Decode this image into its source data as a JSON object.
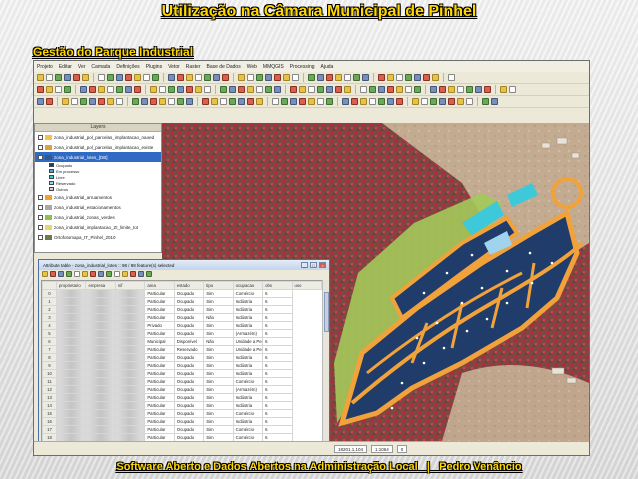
{
  "slide": {
    "title": "Utilização na Câmara Municipal de Pinhel",
    "subtitle": "Gestão do Parque Industrial",
    "footer": "Software Aberto e Dados Abertos na Administração Local   |   Pedro Venâncio"
  },
  "app": {
    "menu": [
      "Projeto",
      "Editar",
      "Ver",
      "Camada",
      "Definições",
      "Plugins",
      "Vetor",
      "Raster",
      "Base de Dados",
      "Web",
      "MMQGIS",
      "Processing",
      "Ajuda"
    ],
    "layers_panel": {
      "title": "Layers",
      "layers": [
        {
          "name": "zona_industrial_pol_parcelas_implantacao_naoed",
          "color": "#f2c24a",
          "checked": true,
          "selected": false
        },
        {
          "name": "zona_industrial_pol_parcelas_implantacao_existe",
          "color": "#d9a23a",
          "checked": true,
          "selected": false
        },
        {
          "name": "zona_industrial_lotes_[DB]",
          "color": "#2e5a8c",
          "checked": true,
          "selected": true
        },
        {
          "name": "zona_industrial_arruamentos",
          "color": "#f0a030",
          "checked": true,
          "selected": false
        },
        {
          "name": "zona_industrial_estacionamentos",
          "color": "#a8a8a8",
          "checked": true,
          "selected": false
        },
        {
          "name": "zona_industrial_zonas_verdes",
          "color": "#8bc34a",
          "checked": true,
          "selected": false
        },
        {
          "name": "zona_industrial_implantacao_ZI_limite_tot",
          "color": "#e5d66a",
          "checked": true,
          "selected": false
        },
        {
          "name": "Ortofotomapa_IT_Pinhel_2010",
          "color": "#6b7b4a",
          "checked": true,
          "selected": false
        }
      ],
      "legend": [
        {
          "label": "Ocupado",
          "color": "#1e3f6e"
        },
        {
          "label": "Em processo",
          "color": "#4aa3df"
        },
        {
          "label": "Livre",
          "color": "#40c7d9"
        },
        {
          "label": "Reservado",
          "color": "#a7d4ef"
        },
        {
          "label": "Outros",
          "color": "#d0d0d0"
        }
      ]
    },
    "attribute_table": {
      "title": "Attribute table - zona_industrial_lotes :: 98 / 98 feature(s) selected",
      "columns": [
        "Id",
        "proprietario",
        "empresa",
        "nif",
        "area",
        "estado",
        "tipo",
        "ocupacao",
        "obs",
        "uso"
      ],
      "rows": [
        [
          "0",
          "",
          "",
          "",
          "Particular",
          "Ocupado",
          "Sim",
          "Comércio",
          "6"
        ],
        [
          "1",
          "",
          "",
          "",
          "Particular",
          "Ocupado",
          "Sim",
          "Indústria",
          "6"
        ],
        [
          "2",
          "",
          "",
          "",
          "Particular",
          "Ocupado",
          "Sim",
          "Indústria",
          "6"
        ],
        [
          "3",
          "",
          "",
          "",
          "Particular",
          "Ocupado",
          "Não",
          "Indústria",
          "6"
        ],
        [
          "4",
          "",
          "",
          "",
          "Privado",
          "Ocupado",
          "Sim",
          "Indústria",
          "6"
        ],
        [
          "5",
          "",
          "",
          "",
          "Particular",
          "Ocupado",
          "Sim",
          "(Armazém)",
          "6"
        ],
        [
          "6",
          "",
          "",
          "",
          "Municipal",
          "Disponível",
          "Não",
          "Unidade a Perfis",
          "6"
        ],
        [
          "7",
          "",
          "",
          "",
          "Particular",
          "Reservado",
          "Sim",
          "Unidade a Perfis",
          "6"
        ],
        [
          "8",
          "",
          "",
          "",
          "Particular",
          "Ocupado",
          "Sim",
          "Indústria",
          "6"
        ],
        [
          "9",
          "",
          "",
          "",
          "Particular",
          "Ocupado",
          "Sim",
          "Indústria",
          "6"
        ],
        [
          "10",
          "",
          "",
          "",
          "Particular",
          "Ocupado",
          "Sim",
          "Indústria",
          "6"
        ],
        [
          "11",
          "",
          "",
          "",
          "Particular",
          "Ocupado",
          "Sim",
          "Comércio",
          "6"
        ],
        [
          "12",
          "",
          "",
          "",
          "Particular",
          "Ocupado",
          "Sim",
          "(Armazém)",
          "6"
        ],
        [
          "13",
          "",
          "",
          "",
          "Particular",
          "Ocupado",
          "Sim",
          "Indústria",
          "6"
        ],
        [
          "14",
          "",
          "",
          "",
          "Particular",
          "Ocupado",
          "Sim",
          "Indústria",
          "6"
        ],
        [
          "15",
          "",
          "",
          "",
          "Particular",
          "Ocupado",
          "Sim",
          "Comércio",
          "6"
        ],
        [
          "16",
          "",
          "",
          "",
          "Particular",
          "Ocupado",
          "Sim",
          "Indústria",
          "6"
        ],
        [
          "17",
          "",
          "",
          "",
          "Particular",
          "Ocupado",
          "Sim",
          "Comércio",
          "6"
        ],
        [
          "18",
          "",
          "",
          "",
          "Particular",
          "Ocupado",
          "Sim",
          "Comércio",
          "6"
        ],
        [
          "19",
          "",
          "",
          "",
          "Particular",
          "Ocupado",
          "Sim",
          "Indústria",
          "6"
        ]
      ],
      "status": "Show all features"
    },
    "statusbar": {
      "coordinate": "18201.1,104",
      "scale": "1:1064",
      "rotation": "0"
    }
  }
}
